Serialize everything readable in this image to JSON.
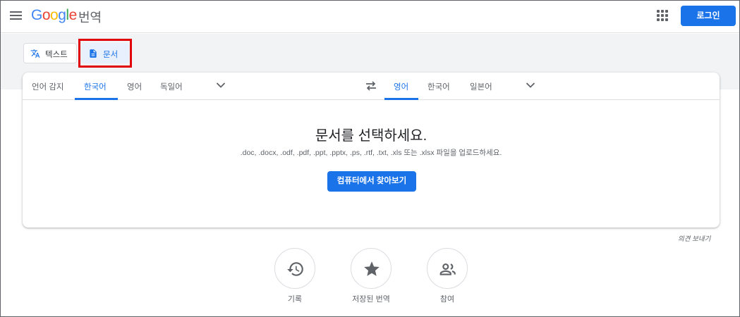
{
  "header": {
    "logo_letters": [
      "G",
      "o",
      "o",
      "g",
      "l",
      "e"
    ],
    "product_name": "번역",
    "login_label": "로그인"
  },
  "modes": {
    "text_label": "텍스트",
    "document_label": "문서"
  },
  "source_langs": [
    "언어 감지",
    "한국어",
    "영어",
    "독일어"
  ],
  "target_langs": [
    "영어",
    "한국어",
    "일본어"
  ],
  "selected_source": "한국어",
  "selected_target": "영어",
  "main": {
    "heading": "문서를 선택하세요.",
    "formats_note": ".doc, .docx, .odf, .pdf, .ppt, .pptx, .ps, .rtf, .txt, .xls 또는 .xlsx 파일을 업로드하세요.",
    "browse_label": "컴퓨터에서 찾아보기"
  },
  "feedback_label": "의견 보내기",
  "shortcuts": [
    {
      "label": "기록",
      "icon": "history-icon"
    },
    {
      "label": "저장된 번역",
      "icon": "star-icon"
    },
    {
      "label": "참여",
      "icon": "people-icon"
    }
  ],
  "colors": {
    "accent": "#1a73e8",
    "highlight_border": "#e0000a"
  }
}
